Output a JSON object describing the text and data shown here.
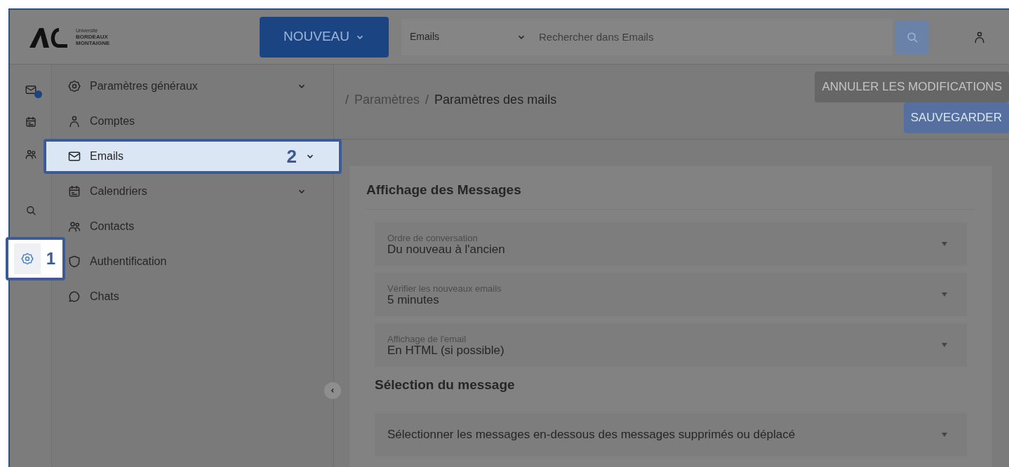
{
  "header": {
    "logo": {
      "line_1": "Université",
      "line_2": "BORDEAUX",
      "line_3": "MONTAIGNE"
    },
    "new_button": "NOUVEAU",
    "search_scope": "Emails",
    "search": {
      "placeholder": "Rechercher dans Emails"
    }
  },
  "rail": [
    {
      "kind": "mail",
      "selected": false,
      "badge": true
    },
    {
      "kind": "calendar",
      "selected": false
    },
    {
      "kind": "contacts",
      "selected": false
    },
    {
      "kind": "search",
      "selected": false
    },
    {
      "kind": "settings",
      "selected": true,
      "callout": "1"
    }
  ],
  "sidebar": {
    "items": [
      {
        "kind": "gear",
        "label": "Paramètres généraux",
        "expandable": true,
        "selected": false
      },
      {
        "kind": "person",
        "label": "Comptes",
        "expandable": false,
        "selected": false
      },
      {
        "kind": "mail",
        "label": "Emails",
        "expandable": true,
        "selected": true,
        "callout": "2"
      },
      {
        "kind": "calendar",
        "label": "Calendriers",
        "expandable": true,
        "selected": false
      },
      {
        "kind": "contacts",
        "label": "Contacts",
        "expandable": false,
        "selected": false
      },
      {
        "kind": "lock",
        "label": "Authentification",
        "expandable": false,
        "selected": false
      },
      {
        "kind": "chat",
        "label": "Chats",
        "expandable": false,
        "selected": false
      }
    ]
  },
  "breadcrumb": [
    {
      "separator": "/",
      "label": "Paramètres"
    },
    {
      "separator": "/",
      "label": "Paramètres des mails"
    }
  ],
  "actions": {
    "cancel": "ANNULER LES MODIFICATIONS",
    "save": "SAUVEGARDER"
  },
  "sections": [
    {
      "title": "Affichage des Messages",
      "fields": [
        {
          "label": "Ordre de conversation",
          "value": "Du nouveau à l'ancien"
        },
        {
          "label": "Vérifier les nouveaux emails",
          "value": "5 minutes"
        },
        {
          "label": "Affichage de l'email",
          "value": "En HTML (si possible)"
        }
      ]
    },
    {
      "title": "Sélection du message",
      "fields": [
        {
          "value": "Sélectionner les messages en-dessous des messages supprimés ou déplacé"
        }
      ]
    }
  ]
}
